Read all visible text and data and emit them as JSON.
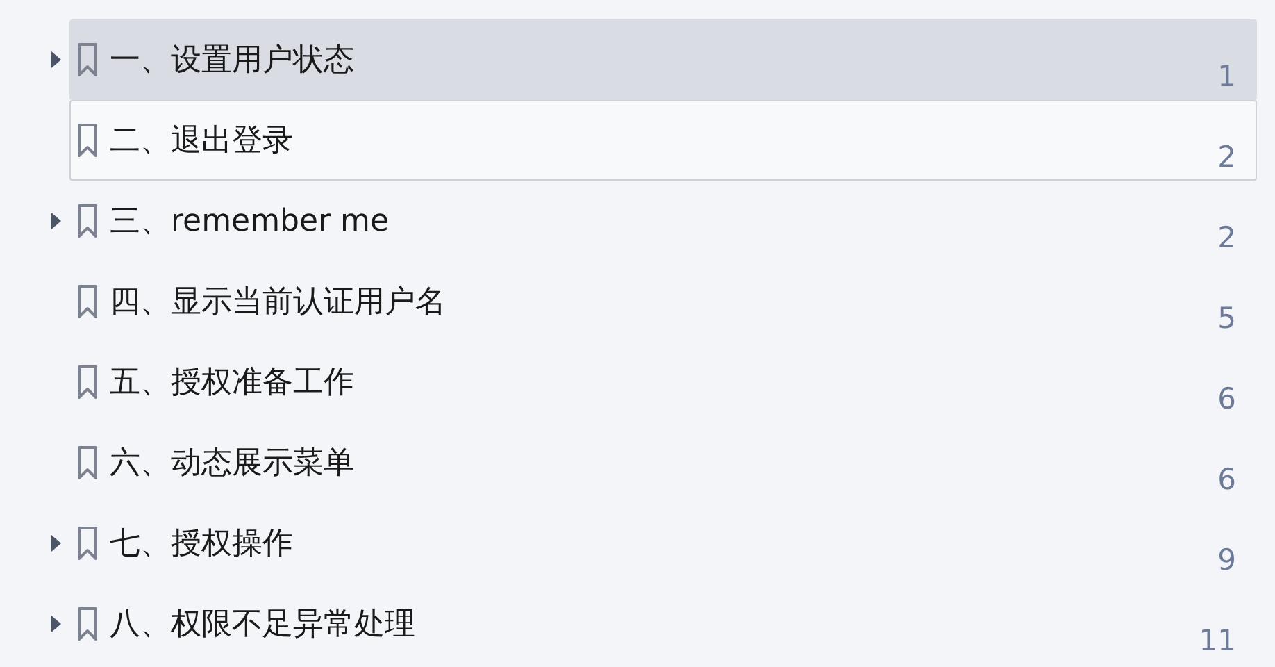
{
  "bookmarks": [
    {
      "title": "一、设置用户状态",
      "page": "1",
      "expandable": true,
      "selected": true,
      "focused": false
    },
    {
      "title": "二、退出登录",
      "page": "2",
      "expandable": false,
      "selected": false,
      "focused": true
    },
    {
      "title": "三、remember me",
      "page": "2",
      "expandable": true,
      "selected": false,
      "focused": false
    },
    {
      "title": "四、显示当前认证用户名",
      "page": "5",
      "expandable": false,
      "selected": false,
      "focused": false
    },
    {
      "title": "五、授权准备工作",
      "page": "6",
      "expandable": false,
      "selected": false,
      "focused": false
    },
    {
      "title": "六、动态展示菜单",
      "page": "6",
      "expandable": false,
      "selected": false,
      "focused": false
    },
    {
      "title": "七、授权操作",
      "page": "9",
      "expandable": true,
      "selected": false,
      "focused": false
    },
    {
      "title": "八、权限不足异常处理",
      "page": "11",
      "expandable": true,
      "selected": false,
      "focused": false
    }
  ]
}
